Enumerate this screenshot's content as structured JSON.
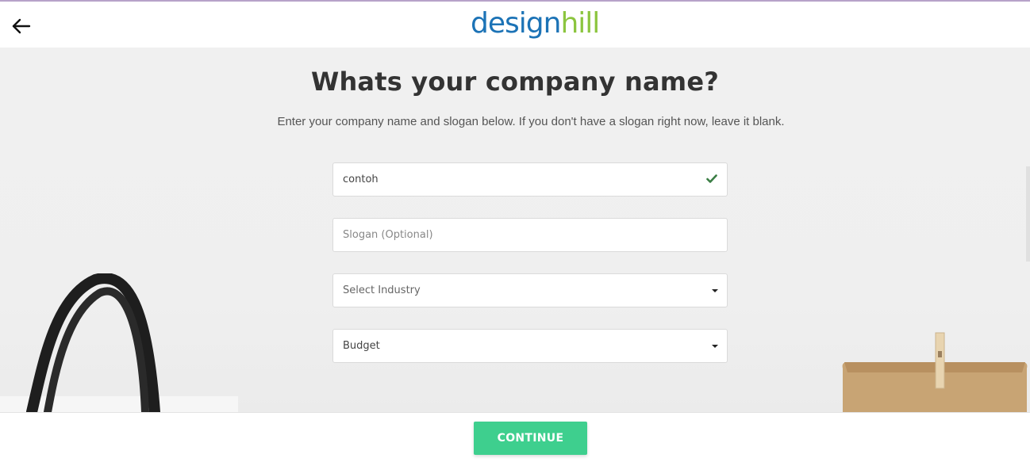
{
  "header": {
    "logo_part1": "design",
    "logo_part2": "hill",
    "back_icon": "arrow-left-icon"
  },
  "main": {
    "title": "Whats your company name?",
    "subtitle": "Enter your company name and slogan below. If you don't have a slogan right now, leave it blank."
  },
  "form": {
    "company_name_value": "contoh",
    "company_name_icon": "checkmark-icon",
    "slogan_placeholder": "Slogan (Optional)",
    "slogan_value": "",
    "industry_selected": "Select Industry",
    "budget_selected": "Budget"
  },
  "footer": {
    "continue_label": "CONTINUE"
  },
  "colors": {
    "brand_blue": "#1c73b6",
    "brand_green": "#8cc53f",
    "continue_button": "#3ecf8e",
    "check_green": "#3a7d44"
  }
}
